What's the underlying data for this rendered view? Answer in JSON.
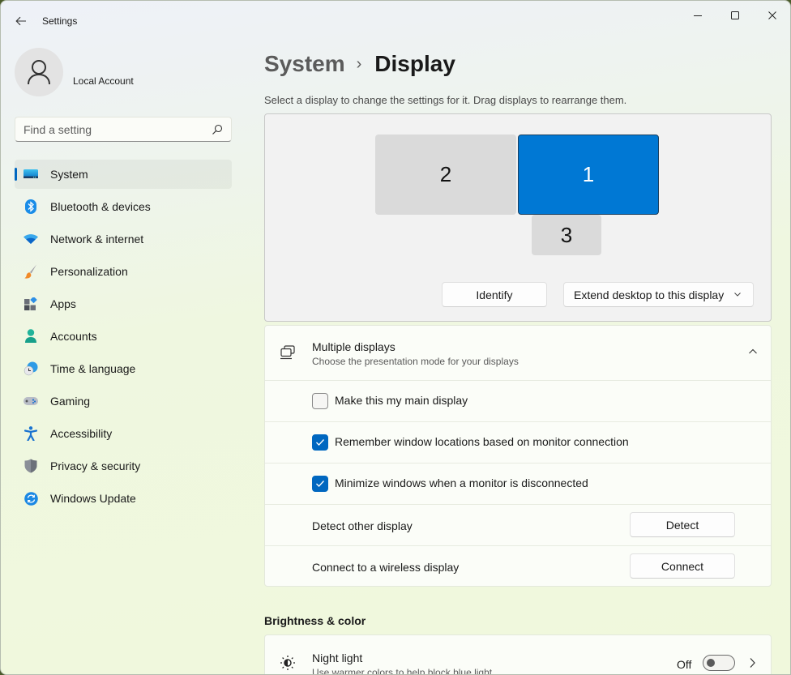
{
  "window": {
    "title": "Settings",
    "controls": {
      "minimize": "minimize",
      "maximize": "maximize",
      "close": "close"
    }
  },
  "account": {
    "name": "Local Account"
  },
  "search": {
    "placeholder": "Find a setting",
    "value": ""
  },
  "sidebar": {
    "items": [
      {
        "label": "System",
        "icon": "system-icon",
        "active": true
      },
      {
        "label": "Bluetooth & devices",
        "icon": "bluetooth-icon",
        "active": false
      },
      {
        "label": "Network & internet",
        "icon": "wifi-icon",
        "active": false
      },
      {
        "label": "Personalization",
        "icon": "brush-icon",
        "active": false
      },
      {
        "label": "Apps",
        "icon": "apps-icon",
        "active": false
      },
      {
        "label": "Accounts",
        "icon": "accounts-icon",
        "active": false
      },
      {
        "label": "Time & language",
        "icon": "time-language-icon",
        "active": false
      },
      {
        "label": "Gaming",
        "icon": "gamepad-icon",
        "active": false
      },
      {
        "label": "Accessibility",
        "icon": "accessibility-icon",
        "active": false
      },
      {
        "label": "Privacy & security",
        "icon": "shield-icon",
        "active": false
      },
      {
        "label": "Windows Update",
        "icon": "update-icon",
        "active": false
      }
    ]
  },
  "breadcrumb": {
    "parent": "System",
    "separator": "›",
    "current": "Display"
  },
  "description": "Select a display to change the settings for it. Drag displays to rearrange them.",
  "displays": {
    "monitors": [
      {
        "number": "2",
        "selected": false
      },
      {
        "number": "1",
        "selected": true
      },
      {
        "number": "3",
        "selected": false
      }
    ],
    "identify_label": "Identify",
    "mode_selected": "Extend desktop to this display",
    "colors": {
      "selected": "#0078d4",
      "unselected": "#dadada"
    }
  },
  "multiple_displays": {
    "title": "Multiple displays",
    "subtitle": "Choose the presentation mode for your displays",
    "expanded": true,
    "options": [
      {
        "label": "Make this my main display",
        "checked": false
      },
      {
        "label": "Remember window locations based on monitor connection",
        "checked": true
      },
      {
        "label": "Minimize windows when a monitor is disconnected",
        "checked": true
      }
    ],
    "detect": {
      "label": "Detect other display",
      "button": "Detect"
    },
    "connect": {
      "label": "Connect to a wireless display",
      "button": "Connect"
    }
  },
  "brightness": {
    "section_title": "Brightness & color",
    "night_light": {
      "title": "Night light",
      "subtitle": "Use warmer colors to help block blue light",
      "state": "Off",
      "on": false
    }
  },
  "accent_color": "#0067c0"
}
